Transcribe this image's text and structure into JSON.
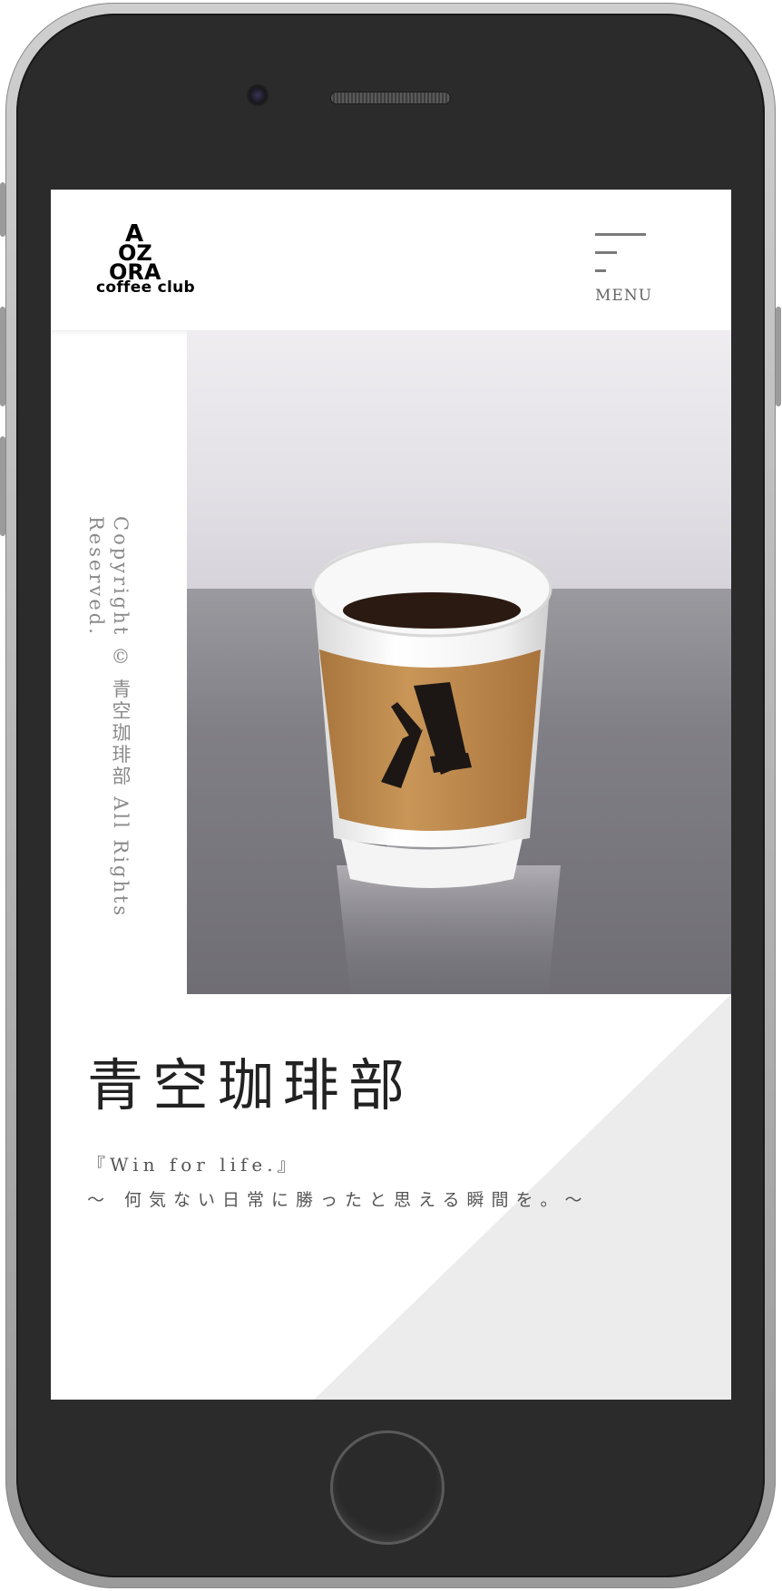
{
  "header": {
    "logo_text_lines": [
      "A",
      "OZ",
      "ORA"
    ],
    "logo_subtitle": "coffee club",
    "menu_label": "MENU"
  },
  "sidebar": {
    "copyright": "Copyright © 青空珈琲部 All Rights Reserved."
  },
  "hero": {
    "cup_mark": "A"
  },
  "main": {
    "brand_title": "青空珈琲部",
    "tagline": "『Win for life.』",
    "subline": "〜 何気ない日常に勝ったと思える瞬間を。〜"
  },
  "colors": {
    "accent_diagonal": "#ececec",
    "text_dark": "#222222",
    "text_muted": "#8a8a8a",
    "device_body": "#2b2b2b"
  },
  "icons": {
    "menu": "hamburger-menu-icon",
    "camera": "front-camera-icon",
    "speaker": "earpiece-speaker-icon",
    "home": "home-button-icon"
  }
}
